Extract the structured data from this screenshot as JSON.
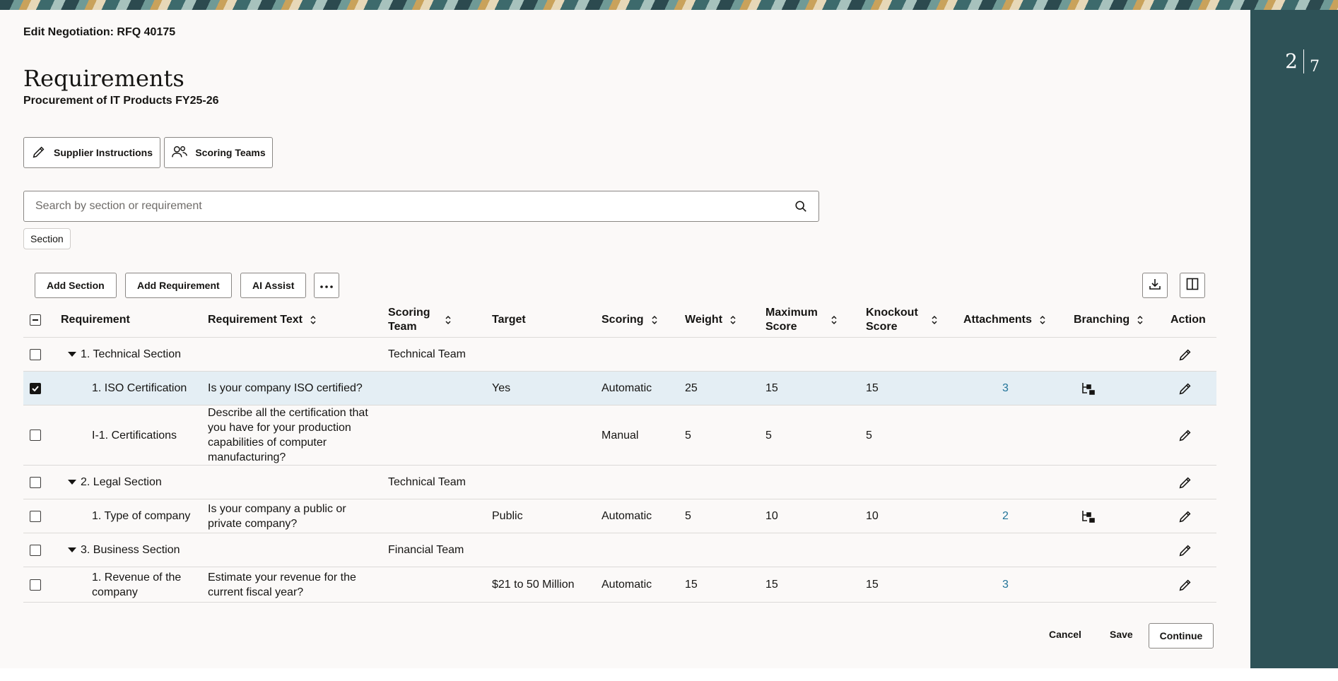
{
  "header": {
    "breadcrumb": "Edit Negotiation: RFQ 40175",
    "title": "Requirements",
    "subtitle": "Procurement of IT Products FY25-26"
  },
  "train": {
    "current": "2",
    "total": "7"
  },
  "actions": {
    "supplier_instructions": "Supplier Instructions",
    "scoring_teams": "Scoring Teams"
  },
  "search": {
    "placeholder": "Search by section or requirement"
  },
  "filter_chip": "Section",
  "toolbar": {
    "add_section": "Add Section",
    "add_requirement": "Add Requirement",
    "ai_assist": "AI Assist"
  },
  "columns": {
    "requirement": "Requirement",
    "requirement_text": "Requirement Text",
    "scoring_team": "Scoring Team",
    "target": "Target",
    "scoring": "Scoring",
    "weight": "Weight",
    "maximum_score": "Maximum Score",
    "knockout_score": "Knockout Score",
    "attachments": "Attachments",
    "branching": "Branching",
    "action": "Action"
  },
  "rows": [
    {
      "type": "section",
      "checked": false,
      "requirement": "1. Technical Section",
      "text": "",
      "team": "Technical Team",
      "target": "",
      "scoring": "",
      "weight": "",
      "max": "",
      "knockout": "",
      "attachments": "",
      "branching": false
    },
    {
      "type": "req",
      "checked": true,
      "requirement": "1. ISO Certification",
      "text": "Is your company ISO certified?",
      "team": "",
      "target": "Yes",
      "scoring": "Automatic",
      "weight": "25",
      "max": "15",
      "knockout": "15",
      "attachments": "3",
      "branching": true
    },
    {
      "type": "req",
      "checked": false,
      "requirement": "I-1. Certifications",
      "text": "Describe all the certification that you have for your production capabilities of computer manufacturing?",
      "team": "",
      "target": "",
      "scoring": "Manual",
      "weight": "5",
      "max": "5",
      "knockout": "5",
      "attachments": "",
      "branching": false
    },
    {
      "type": "section",
      "checked": false,
      "requirement": "2. Legal Section",
      "text": "",
      "team": "Technical Team",
      "target": "",
      "scoring": "",
      "weight": "",
      "max": "",
      "knockout": "",
      "attachments": "",
      "branching": false
    },
    {
      "type": "req",
      "checked": false,
      "requirement": "1. Type of company",
      "text": "Is your company a public or private company?",
      "team": "",
      "target": "Public",
      "scoring": "Automatic",
      "weight": "5",
      "max": "10",
      "knockout": "10",
      "attachments": "2",
      "branching": true
    },
    {
      "type": "section",
      "checked": false,
      "requirement": "3. Business Section",
      "text": "",
      "team": "Financial Team",
      "target": "",
      "scoring": "",
      "weight": "",
      "max": "",
      "knockout": "",
      "attachments": "",
      "branching": false
    },
    {
      "type": "req",
      "checked": false,
      "requirement": "1. Revenue of the company",
      "text": "Estimate your revenue for the current fiscal year?",
      "team": "",
      "target": "$21 to 50 Million",
      "scoring": "Automatic",
      "weight": "15",
      "max": "15",
      "knockout": "15",
      "attachments": "3",
      "branching": false
    }
  ],
  "footer": {
    "cancel": "Cancel",
    "save": "Save",
    "continue": "Continue"
  }
}
